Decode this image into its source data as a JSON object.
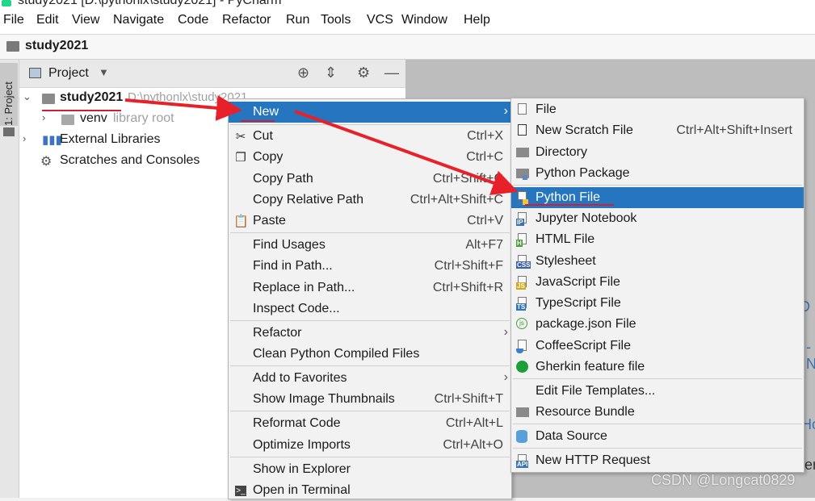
{
  "window": {
    "title": "study2021 [D:\\pythonlx\\study2021] - PyCharm"
  },
  "menubar": [
    "File",
    "Edit",
    "View",
    "Navigate",
    "Code",
    "Refactor",
    "Run",
    "Tools",
    "VCS",
    "Window",
    "Help"
  ],
  "navbar": {
    "project": "study2021"
  },
  "left_strip": {
    "tab_label": "1: Project"
  },
  "project_panel": {
    "title": "Project",
    "tree": [
      {
        "label": "study2021",
        "hint": "D:\\pythonlx\\study2021",
        "expanded": true
      },
      {
        "label": "venv",
        "hint": "library root",
        "expanded": false
      },
      {
        "label": "External Libraries",
        "hint": "",
        "expanded": false
      },
      {
        "label": "Scratches and Consoles",
        "hint": "",
        "expanded": false
      }
    ]
  },
  "context_menu": {
    "items": [
      {
        "label": "New",
        "shortcut": "",
        "icon": "",
        "submenu": true,
        "highlighted": true
      },
      {
        "label": "Cut",
        "shortcut": "Ctrl+X",
        "icon": "scissors-icon"
      },
      {
        "label": "Copy",
        "shortcut": "Ctrl+C",
        "icon": "copy-icon"
      },
      {
        "label": "Copy Path",
        "shortcut": "Ctrl+Shift+C",
        "icon": ""
      },
      {
        "label": "Copy Relative Path",
        "shortcut": "Ctrl+Alt+Shift+C",
        "icon": ""
      },
      {
        "label": "Paste",
        "shortcut": "Ctrl+V",
        "icon": "paste-icon"
      },
      {
        "label": "Find Usages",
        "shortcut": "Alt+F7",
        "icon": ""
      },
      {
        "label": "Find in Path...",
        "shortcut": "Ctrl+Shift+F",
        "icon": ""
      },
      {
        "label": "Replace in Path...",
        "shortcut": "Ctrl+Shift+R",
        "icon": ""
      },
      {
        "label": "Inspect Code...",
        "shortcut": "",
        "icon": ""
      },
      {
        "label": "Refactor",
        "shortcut": "",
        "icon": "",
        "submenu": true
      },
      {
        "label": "Clean Python Compiled Files",
        "shortcut": "",
        "icon": ""
      },
      {
        "label": "Add to Favorites",
        "shortcut": "",
        "icon": "",
        "submenu": true
      },
      {
        "label": "Show Image Thumbnails",
        "shortcut": "Ctrl+Shift+T",
        "icon": ""
      },
      {
        "label": "Reformat Code",
        "shortcut": "Ctrl+Alt+L",
        "icon": ""
      },
      {
        "label": "Optimize Imports",
        "shortcut": "Ctrl+Alt+O",
        "icon": ""
      },
      {
        "label": "Show in Explorer",
        "shortcut": "",
        "icon": ""
      },
      {
        "label": "Open in Terminal",
        "shortcut": "",
        "icon": "terminal-icon"
      }
    ]
  },
  "new_submenu": {
    "items": [
      {
        "label": "File",
        "shortcut": "",
        "icon": "file-icon"
      },
      {
        "label": "New Scratch File",
        "shortcut": "Ctrl+Alt+Shift+Insert",
        "icon": "scratch-file-icon"
      },
      {
        "label": "Directory",
        "shortcut": "",
        "icon": "folder-icon"
      },
      {
        "label": "Python Package",
        "shortcut": "",
        "icon": "package-icon"
      },
      {
        "label": "Python File",
        "shortcut": "",
        "icon": "python-file-icon",
        "highlighted": true
      },
      {
        "label": "Jupyter Notebook",
        "shortcut": "",
        "icon": "jupyter-icon",
        "tag": "IP"
      },
      {
        "label": "HTML File",
        "shortcut": "",
        "icon": "html-file-icon",
        "tag": "H"
      },
      {
        "label": "Stylesheet",
        "shortcut": "",
        "icon": "css-file-icon",
        "tag": "CSS"
      },
      {
        "label": "JavaScript File",
        "shortcut": "",
        "icon": "js-file-icon",
        "tag": "JS"
      },
      {
        "label": "TypeScript File",
        "shortcut": "",
        "icon": "ts-file-icon",
        "tag": "TS"
      },
      {
        "label": "package.json File",
        "shortcut": "",
        "icon": "nodejs-icon"
      },
      {
        "label": "CoffeeScript File",
        "shortcut": "",
        "icon": "coffeescript-icon"
      },
      {
        "label": "Gherkin feature file",
        "shortcut": "",
        "icon": "gherkin-icon"
      },
      {
        "label": "Edit File Templates...",
        "shortcut": "",
        "icon": ""
      },
      {
        "label": "Resource Bundle",
        "shortcut": "",
        "icon": "resource-bundle-icon"
      },
      {
        "label": "Data Source",
        "shortcut": "",
        "icon": "database-icon"
      },
      {
        "label": "New HTTP Request",
        "shortcut": "",
        "icon": "api-icon",
        "tag": "API"
      }
    ]
  },
  "watermark": "CSDN @Longcat0829",
  "colors": {
    "highlight": "#2675bf",
    "annotation": "#e8202a"
  }
}
